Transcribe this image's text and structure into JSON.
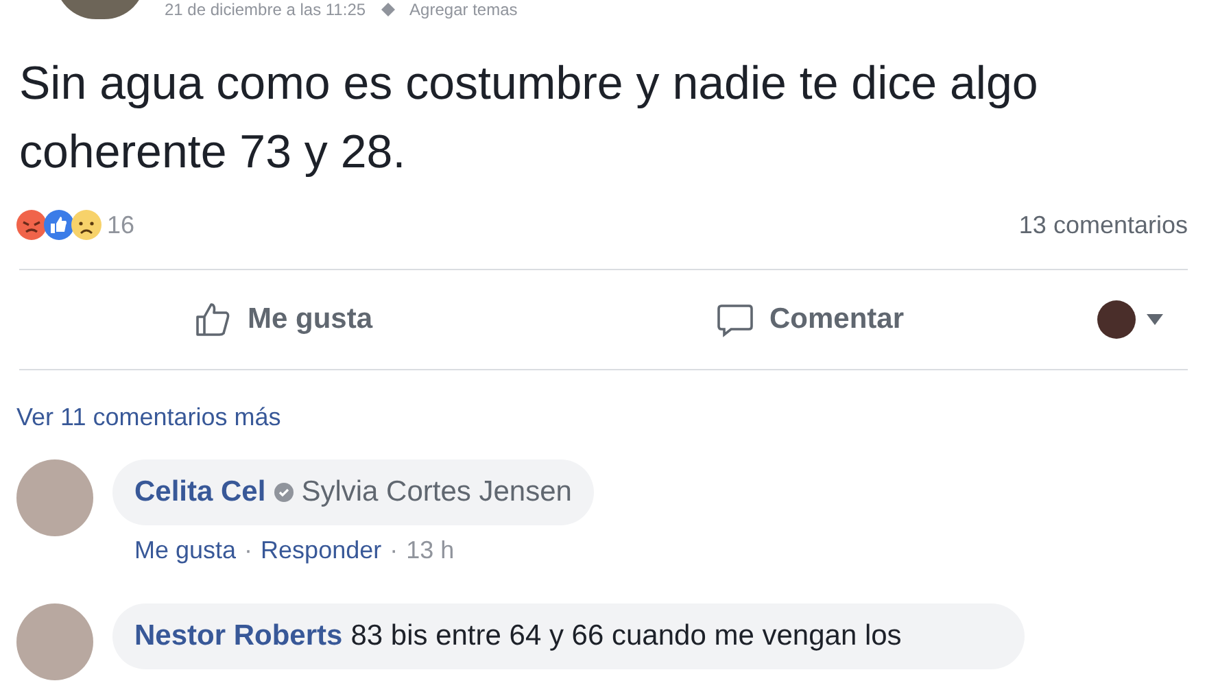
{
  "post": {
    "timestamp": "21 de diciembre a las 11:25",
    "topics_link": "Agregar temas",
    "text": "Sin agua como es costumbre y nadie te dice algo coherente 73 y 28.",
    "reaction_count": "16",
    "comment_count": "13 comentarios"
  },
  "actions": [
    {
      "kind": "like",
      "label": "Me gusta"
    },
    {
      "kind": "comment",
      "label": "Comentar"
    }
  ],
  "more_comments": "Ver 11 comentarios más",
  "comments": [
    {
      "author": "Celita Cel",
      "tagged": "Sylvia Cortes Jensen",
      "links": [
        "Me gusta",
        "Responder"
      ],
      "separator": "·",
      "time": "13 h"
    },
    {
      "author": "Nestor Roberts",
      "text": "83 bis entre 64 y 66 cuando me vengan los"
    }
  ]
}
